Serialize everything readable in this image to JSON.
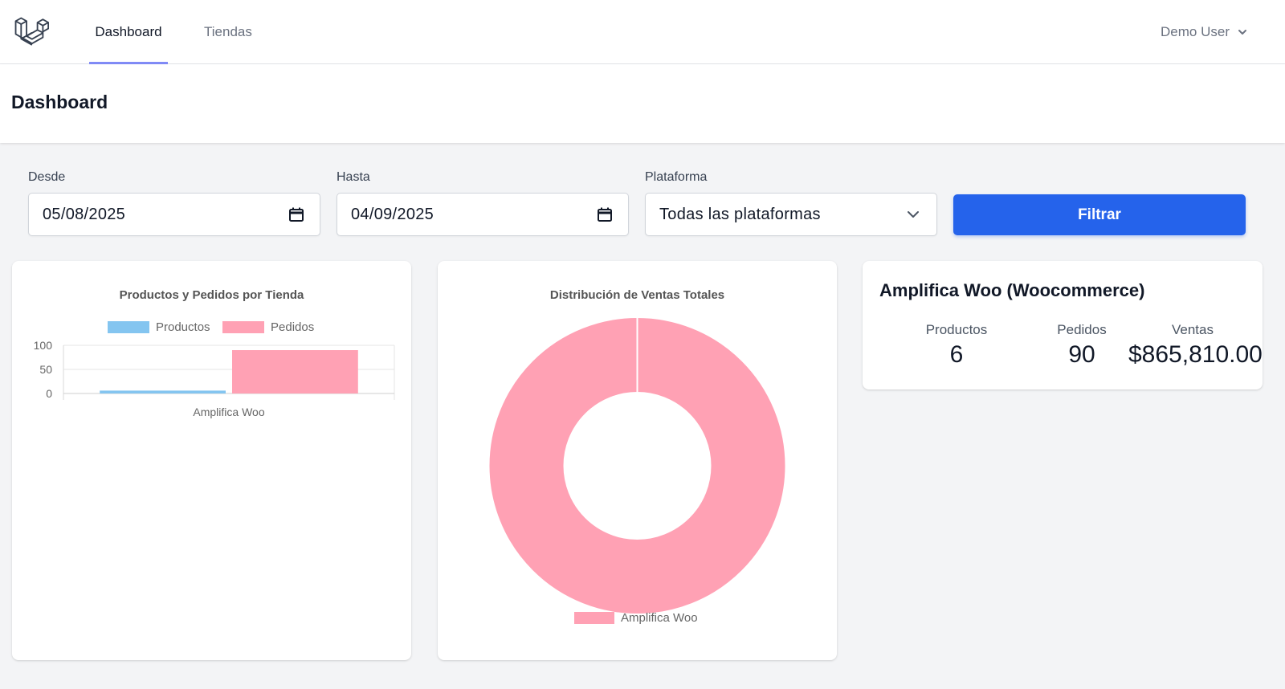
{
  "nav": {
    "tabs": [
      {
        "label": "Dashboard",
        "active": true
      },
      {
        "label": "Tiendas",
        "active": false
      }
    ],
    "user_name": "Demo User"
  },
  "header": {
    "title": "Dashboard"
  },
  "filters": {
    "desde_label": "Desde",
    "desde_value": "05/08/2025",
    "hasta_label": "Hasta",
    "hasta_value": "04/09/2025",
    "plataforma_label": "Plataforma",
    "plataforma_value": "Todas las plataformas",
    "submit_label": "Filtrar"
  },
  "colors": {
    "accent": "#2563eb",
    "nav_underline": "#818cf8",
    "productos": "#84c5f0",
    "pedidos": "#ffa1b4"
  },
  "icons": {
    "logo": "laravel-logo-icon",
    "date": "calendar-icon",
    "select": "chevron-down-icon",
    "user_menu": "chevron-down-icon"
  },
  "chart_data": [
    {
      "type": "bar",
      "title": "Productos y Pedidos por Tienda",
      "categories": [
        "Amplifica Woo"
      ],
      "series": [
        {
          "name": "Productos",
          "values": [
            6
          ]
        },
        {
          "name": "Pedidos",
          "values": [
            90
          ]
        }
      ],
      "yticks": [
        0,
        50,
        100
      ],
      "ylim": [
        0,
        100
      ],
      "legend": "top",
      "grid": true
    },
    {
      "type": "pie",
      "title": "Distribución de Ventas Totales",
      "labels": [
        "Amplifica Woo"
      ],
      "values": [
        865810
      ],
      "legend": "bottom"
    }
  ],
  "store_card": {
    "title": "Amplifica Woo (Woocommerce)",
    "stats": [
      {
        "label": "Productos",
        "value": "6"
      },
      {
        "label": "Pedidos",
        "value": "90"
      },
      {
        "label": "Ventas",
        "value": "$865,810.00"
      }
    ]
  }
}
